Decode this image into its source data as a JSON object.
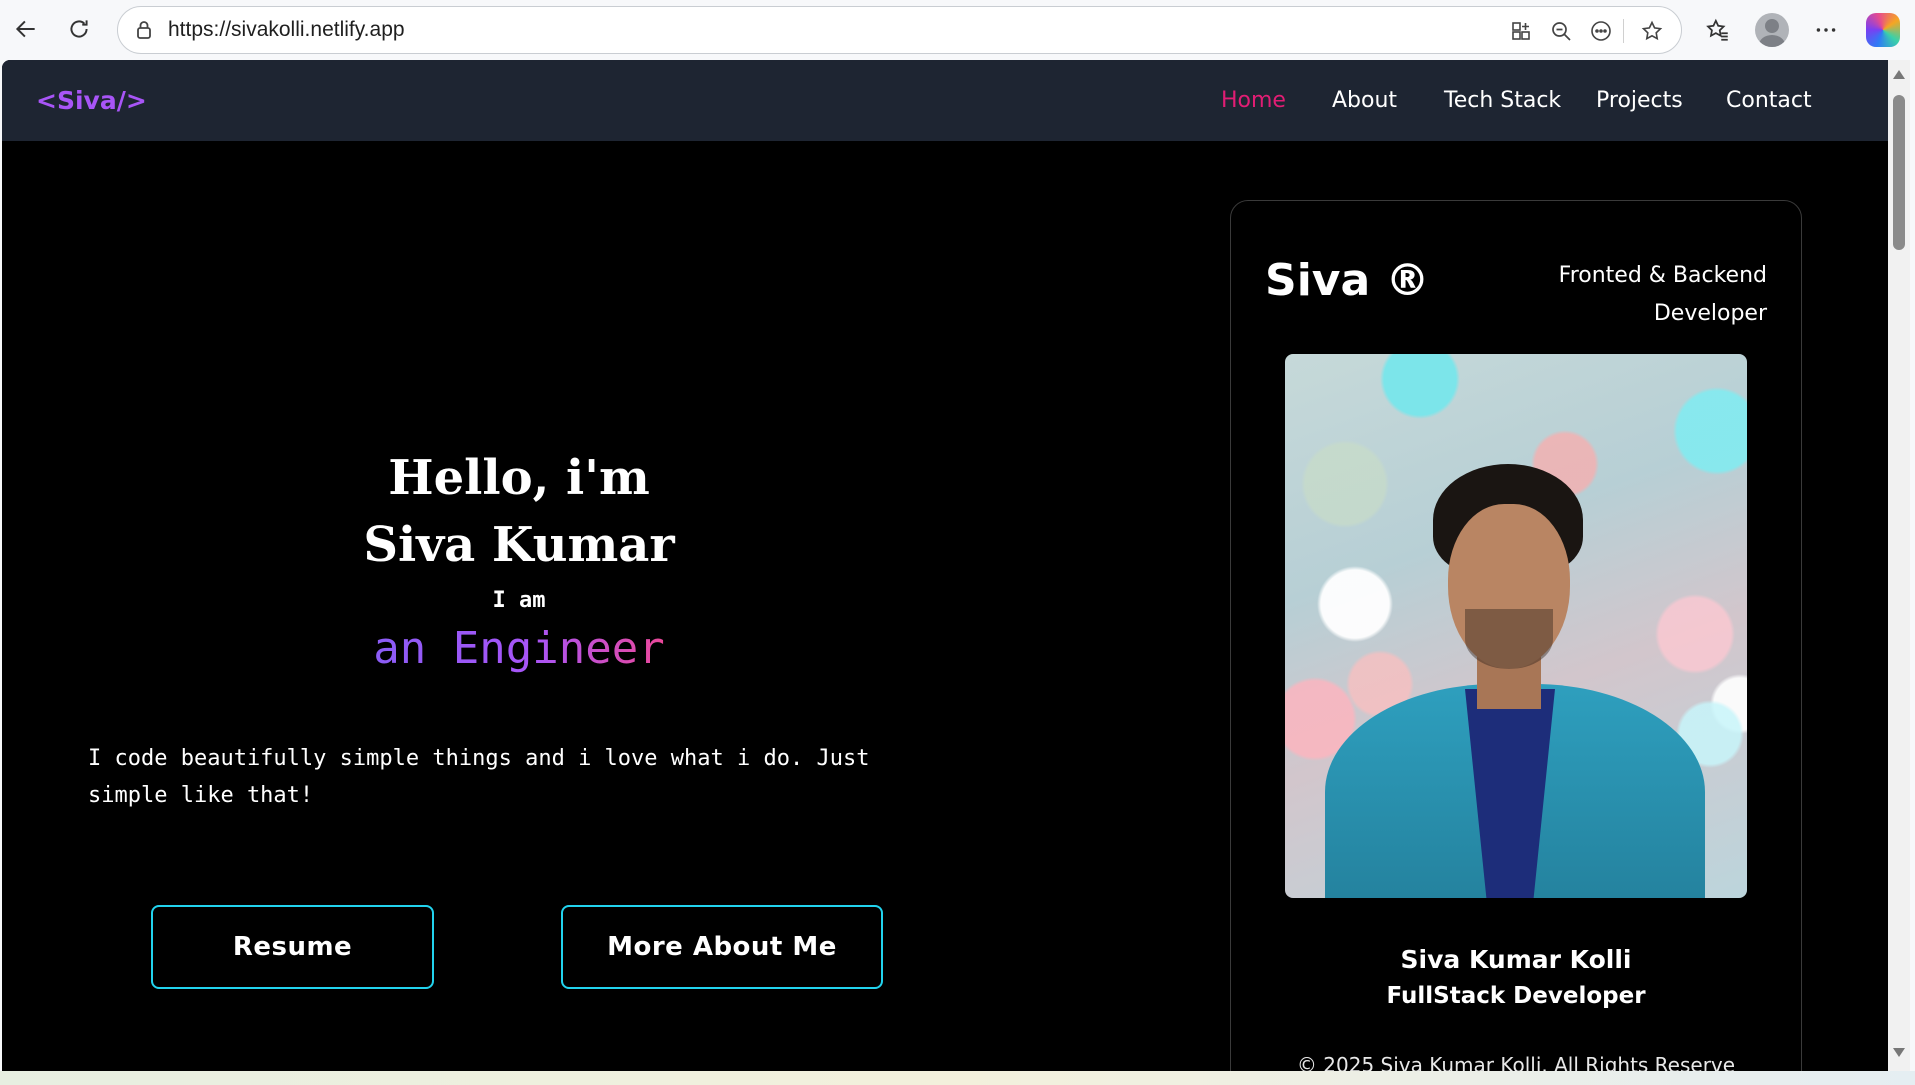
{
  "browser": {
    "url": "https://sivakolli.netlify.app",
    "icons": [
      "back-arrow-icon",
      "reload-icon",
      "lock-icon",
      "app-icon",
      "zoom-out-icon",
      "more-circle-icon",
      "star-icon",
      "favorites-icon",
      "profile-icon",
      "more-icon",
      "copilot-icon"
    ]
  },
  "site": {
    "logo": "<Siva/>",
    "nav": [
      {
        "label": "Home",
        "active": true
      },
      {
        "label": "About"
      },
      {
        "label": "Tech Stack"
      },
      {
        "label": "Projects"
      },
      {
        "label": "Contact"
      }
    ]
  },
  "hero": {
    "greeting_line1": "Hello, i'm",
    "greeting_line2": "Siva Kumar",
    "iam": "I am",
    "role": "an Engineer",
    "tagline": "I code beautifully simple things and i love what i do. Just simple like that!",
    "buttons": {
      "resume": "Resume",
      "more": "More About Me"
    }
  },
  "card": {
    "brand": "Siva ®",
    "role_line1": "Fronted & Backend",
    "role_line2": "Developer",
    "name": "Siva Kumar Kolli",
    "title": "FullStack Developer",
    "copyright": "© 2025 Siva Kumar Kolli. All Rights Reserve"
  },
  "colors": {
    "accent": "#a855f7",
    "active_nav": "#e11d74",
    "button_border": "#22d3ee",
    "nav_bg": "#1e2532"
  }
}
